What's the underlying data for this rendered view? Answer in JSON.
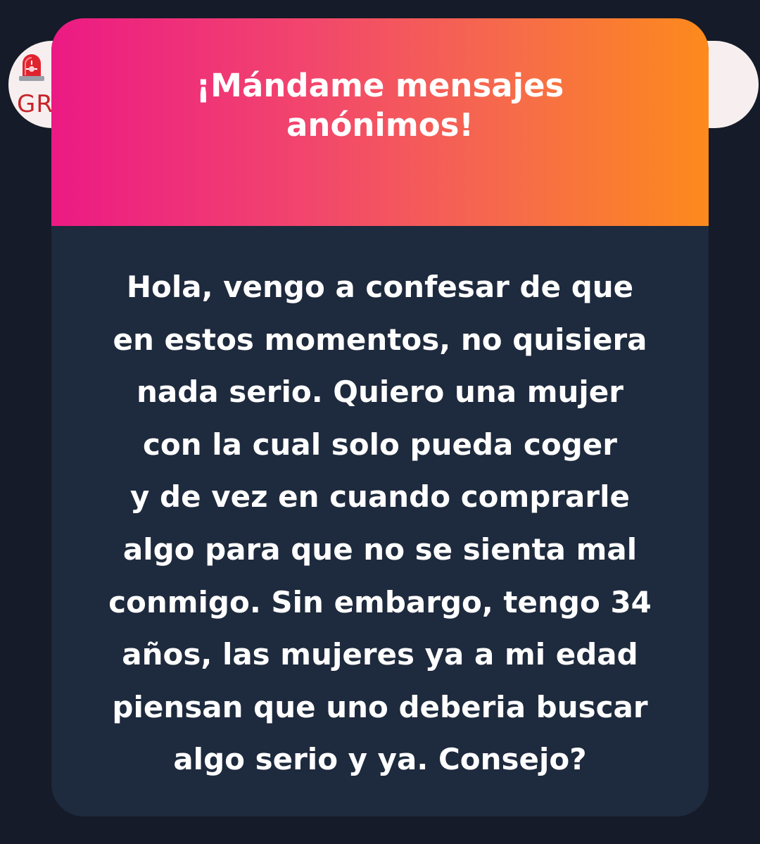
{
  "background_pill": {
    "icon": "rotating-light-icon",
    "text": "GR"
  },
  "card": {
    "title": "¡Mándame mensajes\nanónimos!",
    "message_lines": [
      "Hola, vengo a confesar de que",
      "en estos momentos, no quisiera",
      "nada serio. Quiero una mujer",
      "con la cual solo pueda coger",
      "y de vez en cuando comprarle",
      "algo para que no se sienta mal",
      "conmigo. Sin embargo, tengo 34",
      "años, las mujeres ya a mi edad",
      "piensan que uno deberia buscar",
      "algo serio y ya. Consejo?"
    ]
  },
  "colors": {
    "page_background": "#151b28",
    "card_body": "#1e2a3d",
    "gradient_start": "#ec1a84",
    "gradient_end": "#fd8a1c",
    "pill_text": "#c7232b"
  }
}
